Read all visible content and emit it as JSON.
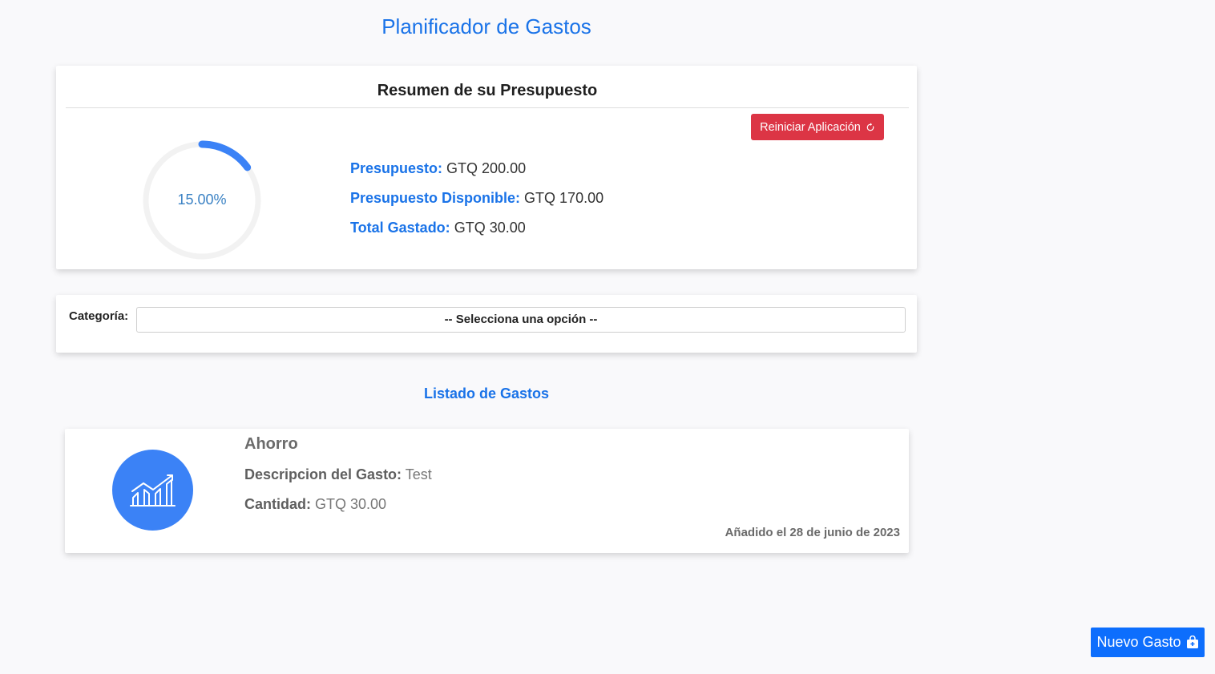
{
  "header": {
    "title": "Planificador de Gastos"
  },
  "summary": {
    "title": "Resumen de su Presupuesto",
    "reset_label": "Reiniciar Aplicación",
    "progress_text": "15.00%",
    "progress_fraction": 0.15,
    "budget_label": "Presupuesto:",
    "budget_value": "GTQ 200.00",
    "available_label": "Presupuesto Disponible:",
    "available_value": "GTQ 170.00",
    "spent_label": "Total Gastado:",
    "spent_value": "GTQ 30.00"
  },
  "filter": {
    "label": "Categoría:",
    "selected": "-- Selecciona una opción --"
  },
  "list": {
    "title": "Listado de Gastos",
    "items": [
      {
        "category": "Ahorro",
        "icon": "savings-chart-icon",
        "desc_label": "Descripcion del Gasto:",
        "desc_value": "Test",
        "amount_label": "Cantidad:",
        "amount_value": "GTQ 30.00",
        "date": "Añadido el 28 de junio de 2023"
      }
    ]
  },
  "actions": {
    "new_expense_label": "Nuevo Gasto"
  },
  "colors": {
    "accent": "#1a73e8",
    "danger": "#dc3545",
    "primary_button": "#0d6efd",
    "icon_circle": "#3b82f6"
  }
}
